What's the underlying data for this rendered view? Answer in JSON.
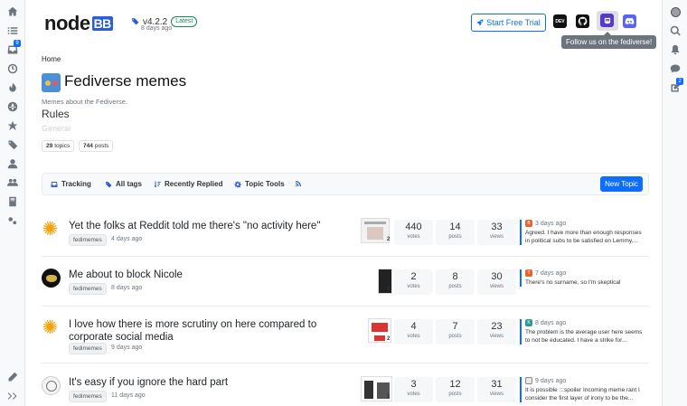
{
  "header": {
    "version": "v4.2.2",
    "latest_label": "Latest",
    "version_date": "8 days ago",
    "trial_label": "Start Free Trial",
    "dev_label": "DEV",
    "tooltip": "Follow us on the fediverse!"
  },
  "sidebar_left": {
    "unread_badge": "9",
    "icons": [
      "home-icon",
      "list-icon",
      "inbox-icon",
      "clock-icon",
      "fire-icon",
      "globe-icon",
      "star-icon",
      "tags-icon",
      "user-icon",
      "users-icon",
      "book-icon",
      "cogs-icon",
      "pen-icon",
      "expand-icon"
    ]
  },
  "sidebar_right": {
    "drafts_badge": "2",
    "icons": [
      "user-avatar",
      "search-icon",
      "bell-icon",
      "chat-icon",
      "edit-icon"
    ]
  },
  "category": {
    "breadcrumb": "Home",
    "title": "Fediverse memes",
    "description": "Memes about the Fediverse.",
    "rules": "Rules",
    "general": "General",
    "topics_count": "29",
    "topics_label": "topics",
    "posts_count": "744",
    "posts_label": "posts"
  },
  "toolbar": {
    "tracking": "Tracking",
    "all_tags": "All tags",
    "recently_replied": "Recently Replied",
    "topic_tools": "Topic Tools",
    "new_topic": "New Topic"
  },
  "topics": [
    {
      "title": "Yet the folks at Reddit told me there's \"no activity here\"",
      "category": "fedimemes",
      "time": "4 days ago",
      "thumb_count": "2",
      "votes": "440",
      "votes_label": "votes",
      "posts": "14",
      "posts_label": "posts",
      "views": "33",
      "views_label": "views",
      "last_avatar_letter": "B",
      "last_avatar_color": "#e8632b",
      "last_time": "3 days ago",
      "last_text": "Agreed. I have more than enough responses in political subs to be satisfied on Lemmy,..."
    },
    {
      "title": "Me about to block Nicole",
      "category": "fedimemes",
      "time": "8 days ago",
      "thumb_count": "2",
      "votes": "2",
      "votes_label": "votes",
      "posts": "8",
      "posts_label": "posts",
      "views": "30",
      "views_label": "views",
      "last_avatar_letter": "T",
      "last_avatar_color": "#e8632b",
      "last_time": "7 days ago",
      "last_text": "There's no surname, so I'm skeptical"
    },
    {
      "title": "I love how there is more scrutiny on here compared to corporate social media",
      "category": "fedimemes",
      "time": "9 days ago",
      "thumb_count": "2",
      "votes": "4",
      "votes_label": "votes",
      "posts": "7",
      "posts_label": "posts",
      "views": "23",
      "views_label": "views",
      "last_avatar_letter": "K",
      "last_avatar_color": "#2a9d8f",
      "last_time": "8 days ago",
      "last_text": "The problem is the average user here seems to not be educated. I have a strike for..."
    },
    {
      "title": "It's easy if you ignore the hard part",
      "category": "fedimemes",
      "time": "11 days ago",
      "thumb_count": "2",
      "votes": "3",
      "votes_label": "votes",
      "posts": "12",
      "posts_label": "posts",
      "views": "31",
      "views_label": "views",
      "last_avatar_letter": "",
      "last_avatar_color": "#888888",
      "last_time": "9 days ago",
      "last_text": "It is possible :::spoiler Incoming meme rant I consider the first layer of irony to be the..."
    }
  ],
  "colors": {
    "accent": "#0d6efd",
    "brand": "#2c5fd6",
    "mastodon": "#563acc",
    "discord": "#5865f2"
  }
}
